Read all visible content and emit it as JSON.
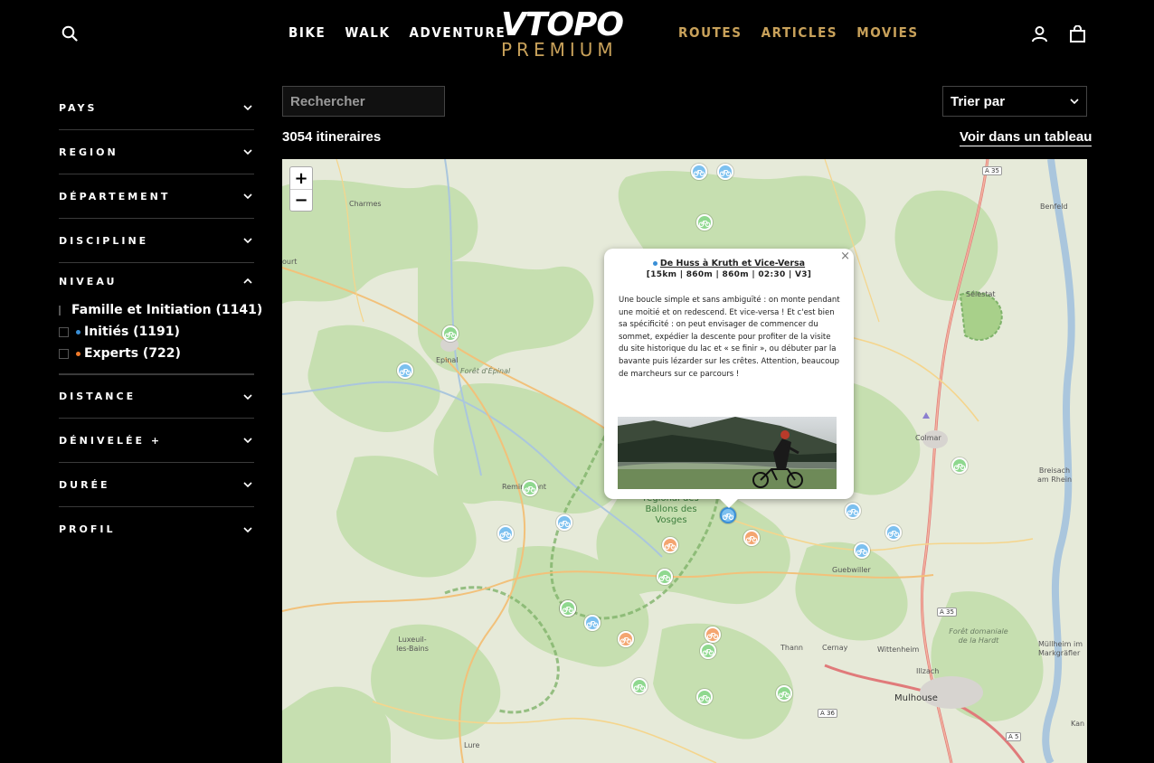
{
  "header": {
    "nav_left": [
      "BIKE",
      "WALK",
      "ADVENTURE"
    ],
    "nav_right": [
      "ROUTES",
      "ARTICLES",
      "MOVIES"
    ],
    "logo_top": "VTOPO",
    "logo_bottom": "PREMIUM",
    "accent_color": "#c8a15a",
    "icons": [
      "search-icon",
      "account-icon",
      "cart-icon"
    ]
  },
  "sidebar": {
    "filters": [
      {
        "label": "PAYS"
      },
      {
        "label": "REGION"
      },
      {
        "label": "DÉPARTEMENT"
      },
      {
        "label": "DISCIPLINE"
      },
      {
        "label": "NIVEAU",
        "open": true,
        "options": [
          {
            "label": "Famille et Initiation (1141)",
            "color": "#3cc23c"
          },
          {
            "label": "Initiés (1191)",
            "color": "#3a8fd6"
          },
          {
            "label": "Experts (722)",
            "color": "#f07a2a"
          }
        ]
      },
      {
        "label": "DISTANCE"
      },
      {
        "label": "DÉNIVELÉE +"
      },
      {
        "label": "DURÉE"
      },
      {
        "label": "PROFIL"
      }
    ]
  },
  "controls": {
    "search_placeholder": "Rechercher",
    "sort_label": "Trier par",
    "count": "3054 itineraires",
    "table_link": "Voir dans un tableau"
  },
  "map": {
    "zoom_in": "+",
    "zoom_out": "−",
    "places": [
      "Charmes",
      "ourt",
      "Epinal",
      "Forêt d'Épinal",
      "Remiremont",
      "Luxeuil-les-Bains",
      "Lure",
      "Thann",
      "Cernay",
      "Wittenheim",
      "Illzach",
      "Mulhouse",
      "Guebwiller",
      "Colmar",
      "Sélestat",
      "Benfeld",
      "Breisach am Rhein",
      "Forêt domaniale de la Hardt",
      "Müllheim im Markgräfler",
      "Kan"
    ],
    "park_label": "régional des Ballons des Vosges",
    "roads": [
      "A 35",
      "A 35",
      "A 36",
      "A 5"
    ]
  },
  "popup": {
    "title": "De Huss à Kruth et Vice-Versa",
    "stats": "[15km | 860m | 860m | 02:30 | V3]",
    "description": "Une boucle simple et sans ambiguïté : on monte pendant une moitié et on redescend. Et vice-versa ! Et c'est bien sa spécificité : on peut envisager de commencer du sommet, expédier la descente pour profiter de la visite du site historique du lac et « se finir », ou débuter par la bavante puis lézarder sur les crêtes. Attention, beaucoup de marcheurs sur ce parcours !",
    "close": "×"
  }
}
